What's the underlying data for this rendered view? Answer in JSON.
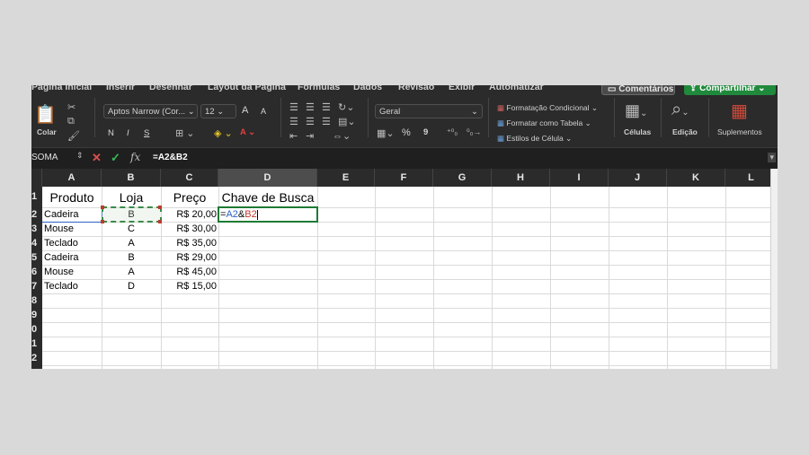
{
  "ribbon": {
    "tabs": [
      "Página Inicial",
      "Inserir",
      "Desenhar",
      "Layout da Página",
      "Fórmulas",
      "Dados",
      "Revisão",
      "Exibir",
      "Automatizar"
    ],
    "comments_label": "Comentários",
    "share_label": "Compartilhar",
    "paste_label": "Colar",
    "font_name": "Aptos Narrow (Cor...",
    "font_size": "12",
    "font_grow": "A",
    "font_shrink": "A",
    "bold": "N",
    "italic": "I",
    "underline": "S",
    "font_color_glyph": "A",
    "number_format": "Geral",
    "percent": "%",
    "comma": "9",
    "conditional_format": "Formatação Condicional",
    "format_as_table": "Formatar como Tabela",
    "cell_styles": "Estilos de Célula",
    "cells_label": "Células",
    "edit_label": "Edição",
    "addins_label": "Suplementos"
  },
  "formula_bar": {
    "name_box": "SOMA",
    "fx": "fx",
    "formula": "=A2&B2",
    "cancel": "✕",
    "confirm": "✓"
  },
  "sheet": {
    "columns": [
      "A",
      "B",
      "C",
      "D",
      "E",
      "F",
      "G",
      "H",
      "I",
      "J",
      "K",
      "L"
    ],
    "row_numbers": [
      "1",
      "2",
      "3",
      "4",
      "5",
      "6",
      "7",
      "8",
      "9",
      "0",
      "1",
      "2"
    ],
    "headers": {
      "a": "Produto",
      "b": "Loja",
      "c": "Preço",
      "d": "Chave de Busca"
    },
    "rows": [
      {
        "a": "Cadeira",
        "b": "B",
        "c": "R$ 20,00"
      },
      {
        "a": "Mouse",
        "b": "C",
        "c": "R$ 30,00"
      },
      {
        "a": "Teclado",
        "b": "A",
        "c": "R$ 35,00"
      },
      {
        "a": "Cadeira",
        "b": "B",
        "c": "R$ 29,00"
      },
      {
        "a": "Mouse",
        "b": "A",
        "c": "R$ 45,00"
      },
      {
        "a": "Teclado",
        "b": "D",
        "c": "R$ 15,00"
      }
    ],
    "editing": {
      "eq": "=",
      "ref1": "A2",
      "amp": "&",
      "ref2": "B2"
    },
    "colors": {
      "ref1": "#2b63c4",
      "ref2": "#c0392b",
      "active_border": "#1e7b34",
      "ref_box_a": "#2b63c4",
      "ref_box_b": "#c0392b"
    }
  }
}
